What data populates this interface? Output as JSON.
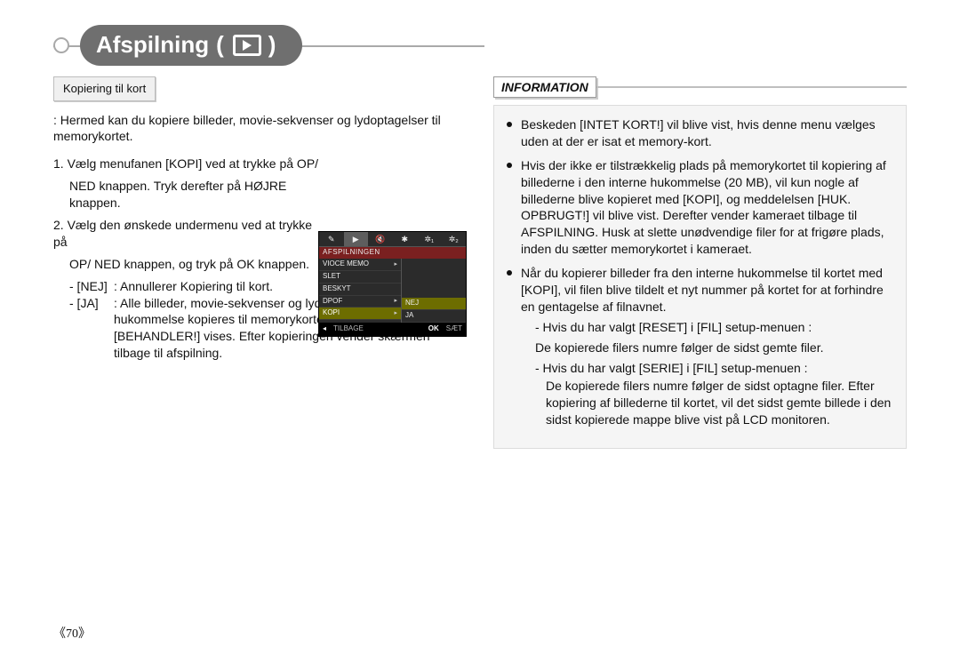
{
  "title": {
    "text": "Afspilning",
    "open": "(",
    "close": ")",
    "icon_name": "play-box-icon"
  },
  "page_number": "《70》",
  "left": {
    "section_tag": "Kopiering til kort",
    "intro": ": Hermed kan du kopiere billeder, movie-sekvenser og lydoptagelser til memorykortet.",
    "step1_a": "1. Vælg menufanen [KOPI] ved at trykke på OP/",
    "step1_b": "NED knappen. Tryk derefter på HØJRE knappen.",
    "step2_a": "2. Vælg den ønskede undermenu ved at trykke på",
    "step2_b": "OP/ NED knappen, og tryk på OK knappen.",
    "opt_nej_label": "- [NEJ]",
    "opt_nej_desc": ": Annullerer Kopiering til kort.",
    "opt_ja_label": "- [JA]",
    "opt_ja_desc": ": Alle billeder, movie-sekvenser og lydoptagelser i den interne hukommelse kopieres til memorykortet, mens meddelelsen [BEHANDLER!] vises. Efter kopieringen vender skærmen tilbage til afspilning."
  },
  "lcd": {
    "icons": [
      "✎",
      "▶",
      "🔇",
      "✱",
      "✲₁",
      "✲₂"
    ],
    "title": "AFSPILNINGEN",
    "items": [
      {
        "label": "VIOCE MEMO",
        "caret": "▸"
      },
      {
        "label": "SLET",
        "caret": ""
      },
      {
        "label": "BESKYT",
        "caret": ""
      },
      {
        "label": "DPOF",
        "caret": "▸"
      },
      {
        "label": "KOPI",
        "caret": "▸",
        "highlight": true
      }
    ],
    "side": [
      {
        "label": "NEJ",
        "highlight": true
      },
      {
        "label": "JA",
        "highlight": false
      }
    ],
    "footer": {
      "back_arrow": "◂",
      "back_label": "TILBAGE",
      "ok_label": "OK",
      "set_label": "SÆT"
    }
  },
  "info": {
    "header": "INFORMATION",
    "bullets": [
      "Beskeden [INTET KORT!] vil blive vist, hvis denne menu vælges uden at der er isat et memory-kort.",
      "Hvis der ikke er tilstrækkelig plads på memorykortet til kopiering af billederne i den interne hukommelse (20 MB), vil kun nogle af billederne blive kopieret med [KOPI], og meddelelsen [HUK. OPBRUGT!] vil blive vist. Derefter vender kameraet tilbage til AFSPILNING. Husk at slette unødvendige filer for at frigøre plads, inden du sætter memorykortet i kameraet.",
      "Når du kopierer billeder fra den interne hukommelse til kortet med [KOPI], vil filen blive tildelt et nyt nummer på kortet for at forhindre en gentagelse af filnavnet."
    ],
    "sub1_label": "- Hvis du har valgt [RESET] i [FIL] setup-menuen :",
    "sub1_text": "De kopierede filers numre følger de sidst gemte filer.",
    "sub2_label": "- Hvis du har valgt [SERIE] i [FIL] setup-menuen :",
    "sub2_text": "De kopierede filers numre følger de sidst optagne filer. Efter kopiering af billederne til kortet, vil det sidst gemte billede i den sidst kopierede mappe blive vist på LCD monitoren."
  }
}
